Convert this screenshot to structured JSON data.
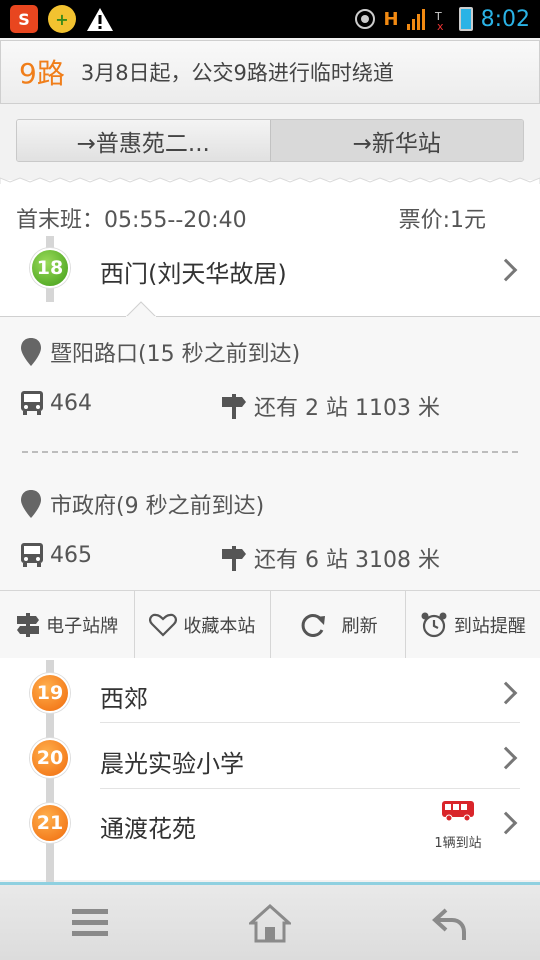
{
  "notice": {
    "route": "9路",
    "message": "3月8日起，公交9路进行临时绕道"
  },
  "tabs": [
    {
      "label": "→普惠苑二..."
    },
    {
      "label": "→新华站"
    }
  ],
  "schedule": {
    "hours": "首末班：05:55--20:40",
    "price": "票价:1元"
  },
  "current_stop": {
    "number": "18",
    "name": "西门(刘天华故居)"
  },
  "buses": [
    {
      "location": "暨阳路口(15 秒之前到达)",
      "plate": "464",
      "remaining": "还有 2 站 1103 米"
    },
    {
      "location": "市政府(9 秒之前到达)",
      "plate": "465",
      "remaining": "还有 6 站 3108 米"
    }
  ],
  "actions": [
    {
      "label": "电子站牌",
      "icon": "signpost-icon"
    },
    {
      "label": "收藏本站",
      "icon": "heart-icon"
    },
    {
      "label": "刷新",
      "icon": "refresh-icon"
    },
    {
      "label": "到站提醒",
      "icon": "alarm-clock-icon"
    }
  ],
  "stops": [
    {
      "number": "19",
      "name": "西郊"
    },
    {
      "number": "20",
      "name": "晨光实验小学"
    },
    {
      "number": "21",
      "name": "通渡花苑",
      "arrival": "1辆到站"
    }
  ],
  "status_bar": {
    "time": "8:02",
    "network": "H"
  },
  "colors": {
    "accent": "#f07e1a",
    "green": "#3f9c17",
    "bus_red": "#d9252a",
    "time_blue": "#2ab3e6"
  }
}
